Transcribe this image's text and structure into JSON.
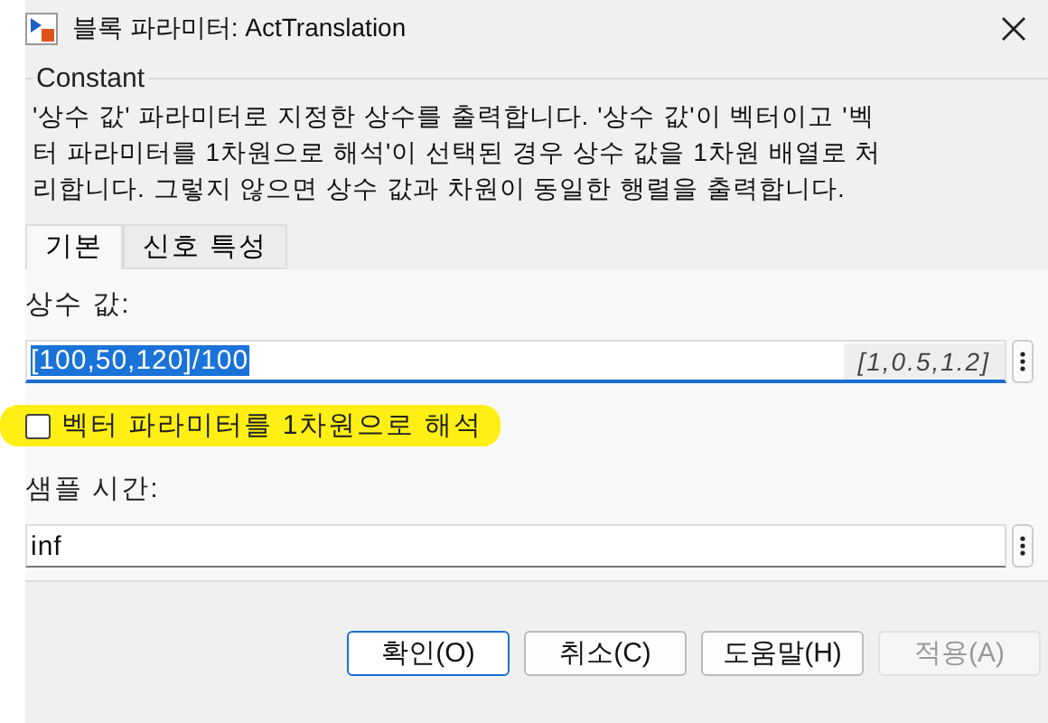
{
  "window": {
    "title": "블록 파라미터: ActTranslation"
  },
  "group": {
    "title": "Constant",
    "description": "'상수 값' 파라미터로 지정한 상수를 출력합니다. '상수 값'이 벡터이고 '벡터 파라미터를 1차원으로 해석'이 선택된 경우 상수 값을 1차원 배열로 처리합니다. 그렇지 않으면 상수 값과 차원이 동일한 행렬을 출력합니다."
  },
  "tabs": [
    {
      "label": "기본",
      "selected": true
    },
    {
      "label": "신호 특성",
      "selected": false
    }
  ],
  "fields": [
    {
      "kind": "text",
      "label": "상수 값:",
      "value": "[100,50,120]/100",
      "hint": "[1,0.5,1.2]",
      "focused": true
    },
    {
      "kind": "checkbox",
      "label": "벡터 파라미터를 1차원으로 해석",
      "checked": false,
      "highlighted": true
    },
    {
      "kind": "text",
      "label": "샘플 시간:",
      "value": "inf",
      "focused": false
    }
  ],
  "buttons": [
    {
      "label": "확인(O)",
      "default": true,
      "disabled": false
    },
    {
      "label": "취소(C)",
      "default": false,
      "disabled": false
    },
    {
      "label": "도움말(H)",
      "default": false,
      "disabled": false
    },
    {
      "label": "적용(A)",
      "default": false,
      "disabled": true
    }
  ]
}
